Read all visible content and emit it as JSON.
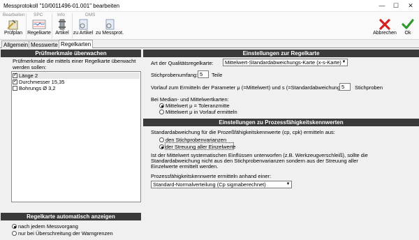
{
  "window": {
    "title": "Messprotokoll \"10/0011496-01.001\" bearbeiten",
    "minimize": "—",
    "maximize": "☐",
    "close": "✕"
  },
  "toolbar": {
    "groups": {
      "bearbeiten": "Bearbeiten",
      "spc": "SPC",
      "info": "Info",
      "dms": "DMS"
    },
    "buttons": {
      "pruefplan": "Prüfplan",
      "regelkarte": "Regelkarte",
      "artikel": "Artikel",
      "zu_artikel": "zu Artikel",
      "zu_messprot": "zu Messprot.",
      "abbrechen": "Abbrechen",
      "ok": "Ok"
    }
  },
  "tabs": [
    "Allgemein",
    "Messwerte",
    "Regelkarten"
  ],
  "left": {
    "header": "Prüfmerkmale überwachen",
    "desc_1": "Prüfmerkmale die mittels einer Regelkarte überwacht",
    "desc_2": "werden sollen:",
    "items": [
      {
        "label": "Länge  2",
        "checked": true
      },
      {
        "label": "Durchmesser 15,35",
        "checked": true
      },
      {
        "label": "Bohrungs Ø 3,2",
        "checked": false
      }
    ],
    "auto_header": "Regelkarte automatisch anzeigen",
    "auto_options": [
      "nach jedem Messvorgang",
      "nur bei Überschreitung der Warngrenzen"
    ]
  },
  "right": {
    "header_regelkarte": "Einstellungen zur Regelkarte",
    "art_label": "Art der Qualitätsregelkarte:",
    "art_value": "Mittelwert-Standardabweichungs-Karte (x-s-Karte)",
    "stichprobe_label": "Stichprobenumfang:",
    "stichprobe_value": "5",
    "stichprobe_unit": "Teile",
    "vorlauf_label": "Vorlauf zum Ermitteln der Parameter μ (=Mittelwert) und s (=Standardabweichung):",
    "vorlauf_value": "5",
    "vorlauf_unit": "Stichproben",
    "median_label": "Bei Median- und Mittelwertkarten:",
    "median_options": [
      "Mittelwert μ = Toleranzmitte",
      "Mittelwert μ in Vorlauf ermitteln"
    ],
    "header_prozess": "Einstellungen zu Prozessfähigkeitskennwerten",
    "std_label": "Standardabweichung für die Prozeßfähigkeitskennwerte (cp, cpk) ermitteln aus:",
    "std_options": [
      "den Stichprobenvarianzen",
      "der Streuung aller Einzelwerte"
    ],
    "note_1": "Ist der Mittelwert systematischen Einflüssen unterworfen (z.B. Werkzeugverschleiß), sollte die",
    "note_2": "Standardabweichung nicht aus den Stichprobenvarianzen sondern aus der Streuung aller",
    "note_3": "Einzelwerte ermittelt werden.",
    "kenn_label": "Prozessfähigkeitskennwerte ermitteln anhand einer:",
    "kenn_value": "Standard-Normalverteilung (Cp sigmaberechnet)"
  }
}
